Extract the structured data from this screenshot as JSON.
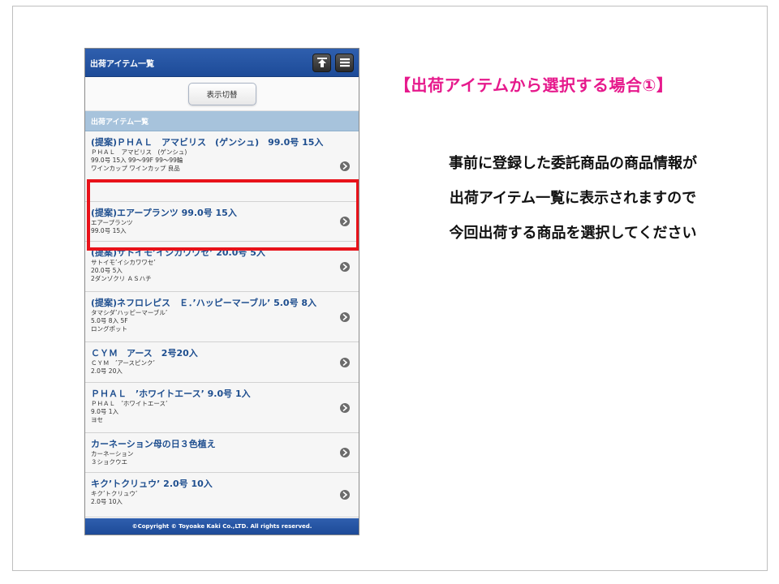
{
  "phone": {
    "title": "出荷アイテム一覧",
    "switch_label": "表示切替",
    "section_label": "出荷アイテム一覧",
    "footer": "©Copyright © Toyoake Kaki Co.,LTD. All rights reserved.",
    "items": [
      {
        "title": "(提案)ＰＨＡＬ　アマビリス　(ゲンシュ)　99.0号 15入",
        "lines": [
          "ＰＨＡＬ　アマビリス　(ゲンシュ)",
          "99.0号 15入 99～99F 99～99輪",
          "ワインカップ ワインカップ 良品"
        ]
      },
      {
        "title": "(提案)エアープランツ 99.0号 15入",
        "lines": [
          "エアープランツ",
          "99.0号 15入"
        ]
      },
      {
        "title": "(提案)サトイモ’イシカワワセ’ 20.0号 5入",
        "lines": [
          "サトイモ’イシカワワセ’",
          "20.0号 5入",
          "2ダンゾクリ ＡＳハチ"
        ]
      },
      {
        "title": "(提案)ネフロレピス　Ｅ．’ハッピーマーブル’ 5.0号 8入",
        "lines": [
          "タマシダ’ハッピーマーブル’",
          "5.0号 8入 5F",
          "ロングポット"
        ]
      },
      {
        "title": "ＣＹＭ　アース　2号20入",
        "lines": [
          "ＣＹＭ　’アースピンク’",
          "2.0号 20入"
        ]
      },
      {
        "title": "ＰＨＡＬ　’ホワイトエース’ 9.0号 1入",
        "lines": [
          "ＰＨＡＬ　’ホワイトエース’",
          "9.0号 1入",
          "ヨセ"
        ]
      },
      {
        "title": "カーネーション母の日３色植え",
        "lines": [
          "カーネーション",
          "３ショクウエ"
        ]
      },
      {
        "title": "キク’トクリュウ’ 2.0号 10入",
        "lines": [
          "キク’トクリュウ’",
          "2.0号 10入"
        ]
      }
    ]
  },
  "heading": "【出荷アイテムから選択する場合①】",
  "description": [
    "事前に登録した委託商品の商品情報が",
    "出荷アイテム一覧に表示されますので",
    "今回出荷する商品を選択してください"
  ],
  "colors": {
    "header_blue": "#1d4b98",
    "section_blue": "#a7c3dc",
    "item_title": "#1e4e8f",
    "heading_pink": "#e6198c",
    "highlight_red": "#e8121a"
  }
}
